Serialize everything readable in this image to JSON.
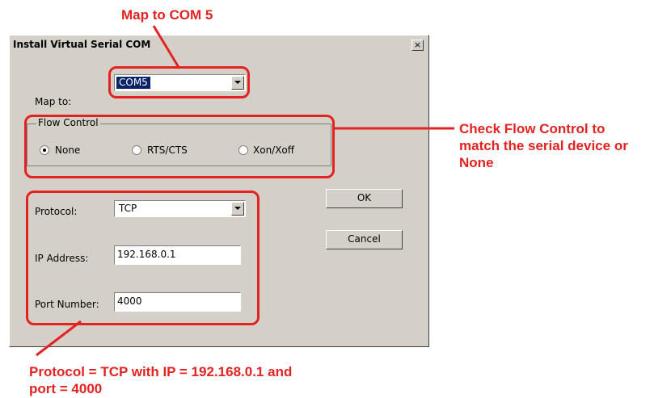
{
  "annotations": {
    "top": "Map to COM 5",
    "right_lines": [
      "Check Flow Control to",
      "match the serial device or",
      "None"
    ],
    "bottom_lines": [
      "Protocol = TCP with IP = 192.168.0.1 and",
      "port = 4000"
    ]
  },
  "dialog": {
    "title": "Install Virtual Serial COM",
    "close_glyph": "×",
    "map_to": {
      "label": "Map to:",
      "value": "COM5"
    },
    "flow_control": {
      "legend": "Flow Control",
      "options": [
        {
          "label": "None",
          "selected": true
        },
        {
          "label": "RTS/CTS",
          "selected": false
        },
        {
          "label": "Xon/Xoff",
          "selected": false
        }
      ]
    },
    "protocol": {
      "label": "Protocol:",
      "value": "TCP"
    },
    "ip_address": {
      "label": "IP Address:",
      "value": "192.168.0.1"
    },
    "port_number": {
      "label": "Port Number:",
      "value": "4000"
    },
    "buttons": {
      "ok": "OK",
      "cancel": "Cancel"
    }
  },
  "colors": {
    "annotation": "#e32222",
    "dialog_bg": "#d4d0c8",
    "selection": "#0a246a"
  }
}
